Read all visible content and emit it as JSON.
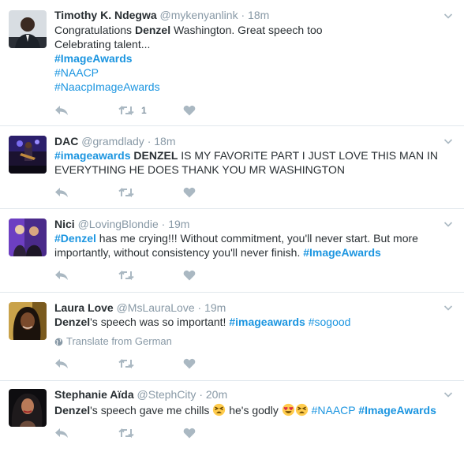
{
  "tweets": [
    {
      "name": "Timothy K. Ndegwa",
      "handle": "@mykenyanlink",
      "dot": "·",
      "time": "18m",
      "lines": [
        [
          {
            "t": "Congratulations "
          },
          {
            "t": "Denzel",
            "bold": true
          },
          {
            "t": " Washington. Great speech too"
          }
        ],
        [
          {
            "t": "Celebrating talent..."
          }
        ],
        [
          {
            "t": "#ImageAwards",
            "tag": true,
            "bold": true
          }
        ],
        [
          {
            "t": "#NAACP",
            "tag": true
          }
        ],
        [
          {
            "t": "#NaacpImageAwards",
            "tag": true
          }
        ]
      ],
      "retweet_count": "1"
    },
    {
      "name": "DAC",
      "handle": "@gramdlady",
      "dot": "·",
      "time": "18m",
      "lines": [
        [
          {
            "t": "#imageawards",
            "tag": true,
            "bold": true
          },
          {
            "t": " "
          },
          {
            "t": "DENZEL",
            "bold": true
          },
          {
            "t": " IS MY FAVORITE PART I JUST LOVE THIS MAN IN"
          }
        ],
        [
          {
            "t": "EVERYTHING HE DOES THANK YOU MR WASHINGTON"
          }
        ]
      ],
      "retweet_count": ""
    },
    {
      "name": "Nici",
      "handle": "@LovingBlondie",
      "dot": "·",
      "time": "19m",
      "lines": [
        [
          {
            "t": "#Denzel",
            "tag": true,
            "bold": true
          },
          {
            "t": " has me crying!!! Without commitment, you'll never start. But more"
          }
        ],
        [
          {
            "t": "importantly, without consistency you'll never finish. "
          },
          {
            "t": "#ImageAwards",
            "tag": true,
            "bold": true
          }
        ]
      ],
      "retweet_count": ""
    },
    {
      "name": "Laura Love",
      "handle": "@MsLauraLove",
      "dot": "·",
      "time": "19m",
      "lines": [
        [
          {
            "t": "Denzel",
            "bold": true
          },
          {
            "t": "'s speech was so important! "
          },
          {
            "t": "#imageawards",
            "tag": true,
            "bold": true
          },
          {
            "t": " "
          },
          {
            "t": "#sogood",
            "tag": true
          }
        ]
      ],
      "translate": "Translate from German",
      "retweet_count": ""
    },
    {
      "name": "Stephanie Aïda",
      "handle": "@StephCity",
      "dot": "·",
      "time": "20m",
      "lines": [
        [
          {
            "t": "Denzel",
            "bold": true
          },
          {
            "t": "'s speech gave me chills "
          },
          {
            "emoji": "tired"
          },
          {
            "t": " he's godly "
          },
          {
            "emoji": "heart-eyes"
          },
          {
            "emoji": "tired"
          },
          {
            "t": " "
          },
          {
            "t": "#NAACP",
            "tag": true
          },
          {
            "t": " "
          },
          {
            "t": "#ImageAwards",
            "tag": true,
            "bold": true
          }
        ]
      ],
      "retweet_count": ""
    }
  ],
  "icons": {
    "reply": "reply-icon",
    "retweet": "retweet-icon",
    "like": "heart-icon",
    "more": "chevron-down-icon",
    "translate": "globe-icon"
  },
  "colors": {
    "hashtag": "#1b95e0",
    "muted": "#8899a6",
    "icon": "#aab8c2",
    "divider": "#e1e8ed",
    "text": "#292f33"
  }
}
